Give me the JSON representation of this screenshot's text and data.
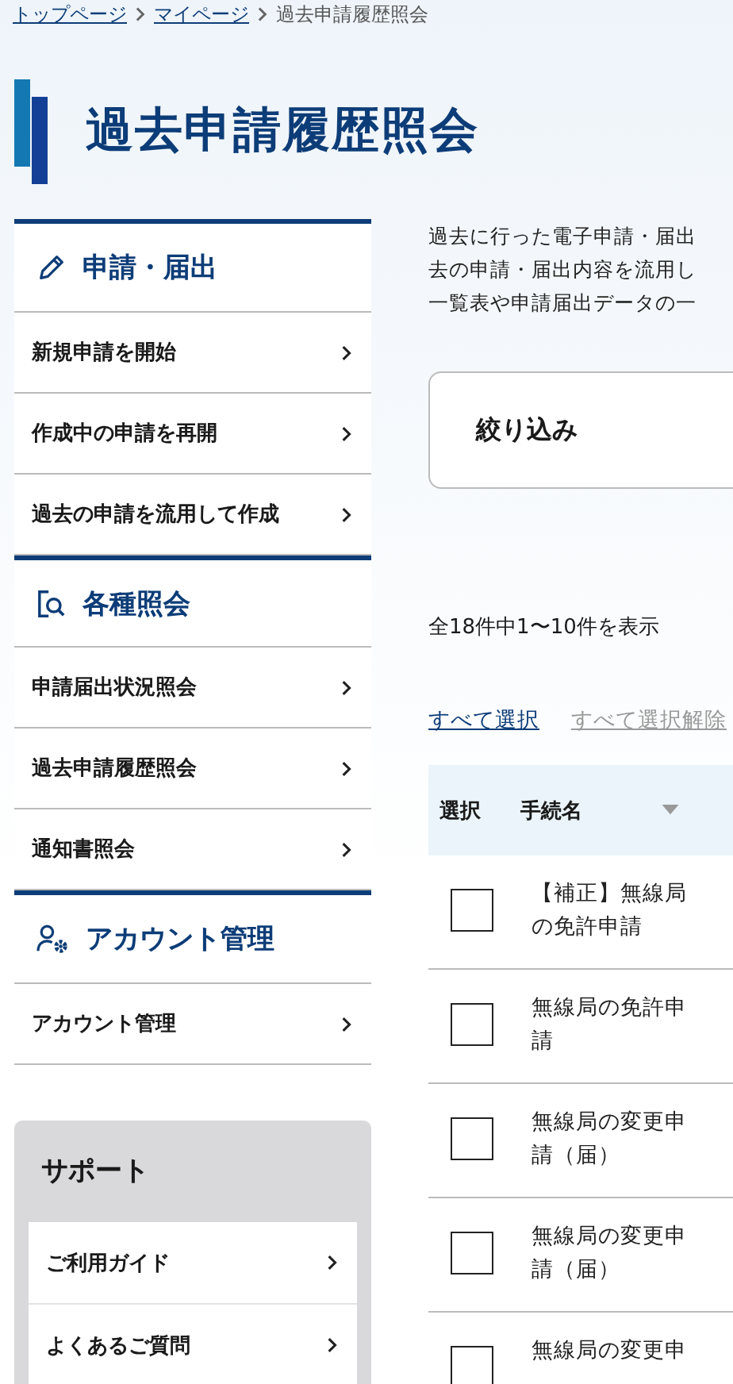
{
  "breadcrumb": [
    {
      "label": "トップページ",
      "kind": "link"
    },
    {
      "label": "マイページ",
      "kind": "link"
    },
    {
      "label": "過去申請履歴照会",
      "kind": "current"
    }
  ],
  "page_title": "過去申請履歴照会",
  "sidebar": {
    "sections": [
      {
        "title": "申請・届出",
        "kind": "apply",
        "items": [
          "新規申請を開始",
          "作成中の申請を再開",
          "過去の申請を流用して作成"
        ]
      },
      {
        "title": "各種照会",
        "kind": "inquiry",
        "items": [
          "申請届出状況照会",
          "過去申請履歴照会",
          "通知書照会"
        ]
      },
      {
        "title": "アカウント管理",
        "kind": "account",
        "items": [
          "アカウント管理"
        ]
      }
    ],
    "support": {
      "title": "サポート",
      "items": [
        "ご利用ガイド",
        "よくあるご質問"
      ]
    }
  },
  "description_lines": [
    "過去に行った電子申請・届出",
    "去の申請・届出内容を流用し",
    "一覧表や申請届出データの一"
  ],
  "filter": {
    "title": "絞り込み"
  },
  "result_count": "全18件中1〜10件を表示",
  "select_links": [
    {
      "label": "すべて選択",
      "disabled": false
    },
    {
      "label": "すべて選択解除",
      "disabled": true
    }
  ],
  "table": {
    "columns": [
      {
        "label": "選択",
        "sortable": false
      },
      {
        "label": "手続名",
        "sortable": true
      }
    ],
    "rows": [
      {
        "checked": false,
        "name": "【補正】無線局の免許申請"
      },
      {
        "checked": false,
        "name": "無線局の免許申請"
      },
      {
        "checked": false,
        "name": "無線局の変更申請（届）"
      },
      {
        "checked": false,
        "name": "無線局の変更申請（届）"
      },
      {
        "checked": false,
        "name": "無線局の変更申"
      }
    ]
  }
}
